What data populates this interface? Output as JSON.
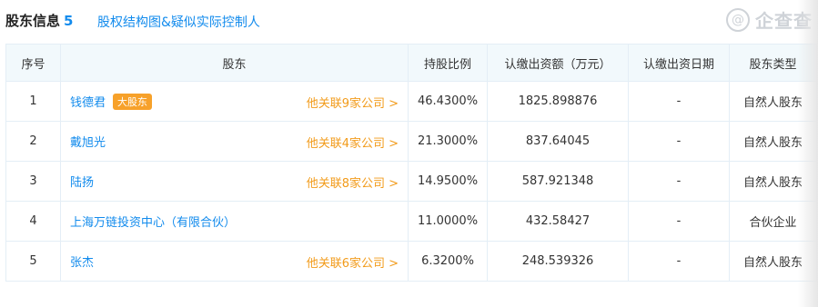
{
  "header": {
    "title": "股东信息",
    "count": "5",
    "structure_link": "股权结构图&疑似实际控制人",
    "watermark_text": "企查查",
    "watermark_icon": "@"
  },
  "table": {
    "columns": [
      "序号",
      "股东",
      "持股比例",
      "认缴出资额（万元）",
      "认缴出资日期",
      "股东类型"
    ],
    "rows": [
      {
        "index": "1",
        "name": "钱德君",
        "badge": "大股东",
        "related": "他关联9家公司 >",
        "ratio": "46.4300%",
        "amount": "1825.898876",
        "date": "-",
        "type": "自然人股东"
      },
      {
        "index": "2",
        "name": "戴旭光",
        "badge": "",
        "related": "他关联4家公司 >",
        "ratio": "21.3000%",
        "amount": "837.64045",
        "date": "-",
        "type": "自然人股东"
      },
      {
        "index": "3",
        "name": "陆扬",
        "badge": "",
        "related": "他关联8家公司 >",
        "ratio": "14.9500%",
        "amount": "587.921348",
        "date": "-",
        "type": "自然人股东"
      },
      {
        "index": "4",
        "name": "上海万链投资中心（有限合伙）",
        "badge": "",
        "related": "",
        "ratio": "11.0000%",
        "amount": "432.58427",
        "date": "-",
        "type": "合伙企业"
      },
      {
        "index": "5",
        "name": "张杰",
        "badge": "",
        "related": "他关联6家公司 >",
        "ratio": "6.3200%",
        "amount": "248.539326",
        "date": "-",
        "type": "自然人股东"
      }
    ]
  },
  "colors": {
    "link": "#128bed",
    "badge": "#f7a12a",
    "related": "#f29b1a",
    "header_bg": "#f2f9fc"
  }
}
